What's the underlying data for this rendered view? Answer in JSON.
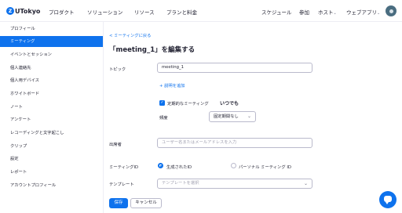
{
  "header": {
    "logo_mark": "Z",
    "logo_text": "UTokyo",
    "nav": [
      "プロダクト",
      "ソリューション",
      "リソース",
      "プランと料金"
    ],
    "right": {
      "schedule": "スケジュール",
      "join": "参加",
      "host": "ホスト",
      "web_app": "ウェブアプリ"
    }
  },
  "sidebar": {
    "items": [
      "プロフィール",
      "ミーティング",
      "イベントとセッション",
      "個人連絡先",
      "個人用デバイス",
      "ホワイトボード",
      "ノート",
      "アンケート",
      "レコーディングと文字起こし",
      "クリップ",
      "設定",
      "レポート",
      "アカウントプロフィール"
    ],
    "active_index": 1
  },
  "form": {
    "back_link": "< ミーティングに戻る",
    "title": "「meeting_1」を編集する",
    "topic_label": "トピック",
    "topic_value": "meeting_1",
    "add_description": "+ 説明を追加",
    "recurring_label": "定期的なミーティング",
    "recurring_checked": true,
    "always_text": "いつでも",
    "frequency_label": "頻度",
    "frequency_value": "固定期間なし",
    "attendees_label": "出席者",
    "attendees_placeholder": "ユーザー名またはメールアドレスを入力",
    "meeting_id_label": "ミーティングID",
    "meeting_id_options": [
      "生成されたID",
      "パーソナル ミーティング ID"
    ],
    "meeting_id_selected": 0,
    "template_label": "テンプレート",
    "template_placeholder": "テンプレートを選択",
    "save_label": "保存",
    "cancel_label": "キャンセル"
  },
  "colors": {
    "accent": "#0e72ed",
    "text": "#232333",
    "border": "#babacc"
  }
}
